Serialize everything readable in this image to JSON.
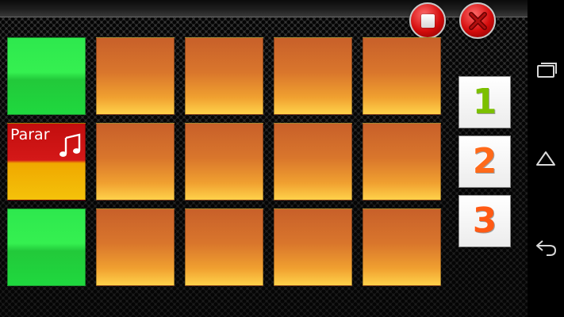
{
  "pads": {
    "stop_label": "Parar"
  },
  "banks": [
    {
      "label": "1",
      "color": "#7cc000"
    },
    {
      "label": "2",
      "color": "#ff6a1a"
    },
    {
      "label": "3",
      "color": "#ff5a14"
    }
  ],
  "colors": {
    "pad_orange": "#d9762c",
    "pad_green": "#2ee84e",
    "stop_red": "#c20e0e",
    "stop_yellow": "#f4c20a",
    "round_button_red": "#d40c0c"
  },
  "icons": {
    "stop": "stop-icon",
    "close": "close-icon",
    "note": "music-note-icon",
    "recents": "recents-icon",
    "home": "home-icon",
    "back": "back-icon"
  }
}
